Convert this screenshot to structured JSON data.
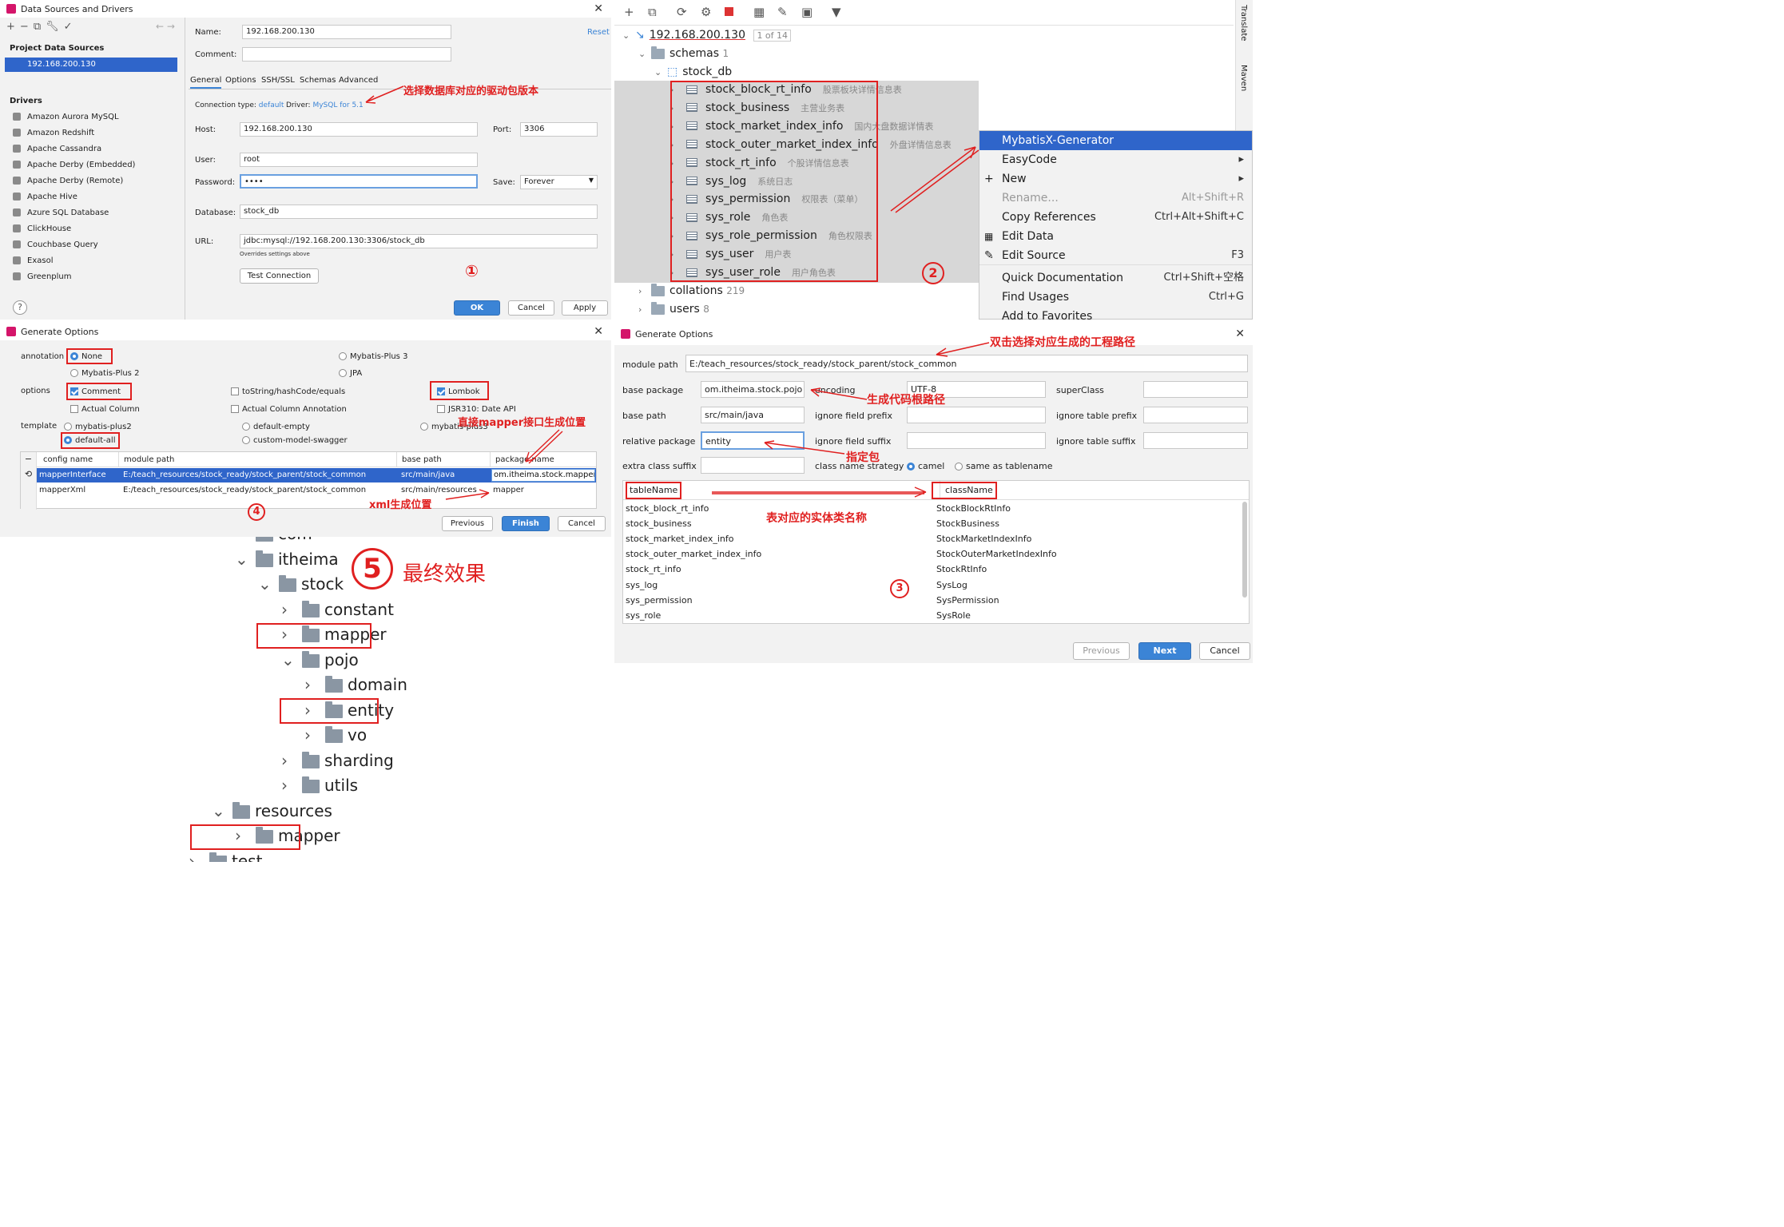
{
  "p1": {
    "title": "Data Sources and Drivers",
    "project_label": "Project Data Sources",
    "selected_source": "192.168.200.130",
    "drivers_label": "Drivers",
    "drivers": [
      "Amazon Aurora MySQL",
      "Amazon Redshift",
      "Apache Cassandra",
      "Apache Derby (Embedded)",
      "Apache Derby (Remote)",
      "Apache Hive",
      "Azure SQL Database",
      "ClickHouse",
      "Couchbase Query",
      "Exasol",
      "Greenplum"
    ],
    "name_label": "Name:",
    "name_value": "192.168.200.130",
    "reset": "Reset",
    "comment_label": "Comment:",
    "tabs": [
      "General",
      "Options",
      "SSH/SSL",
      "Schemas",
      "Advanced"
    ],
    "conn_type_label": "Connection type:",
    "conn_type": "default",
    "driver_label": "Driver:",
    "driver": "MySQL for 5.1",
    "host_label": "Host:",
    "host": "192.168.200.130",
    "port_label": "Port:",
    "port": "3306",
    "user_label": "User:",
    "user": "root",
    "password_label": "Password:",
    "password": "••••",
    "save_label": "Save:",
    "save": "Forever",
    "database_label": "Database:",
    "database": "stock_db",
    "url_label": "URL:",
    "url": "jdbc:mysql://192.168.200.130:3306/stock_db",
    "overrides": "Overrides settings above",
    "test_btn": "Test Connection",
    "ok": "OK",
    "cancel": "Cancel",
    "apply": "Apply",
    "anno": "选择数据库对应的驱动包版本",
    "num": "①"
  },
  "p2": {
    "host": "192.168.200.130",
    "of": "1 of 14",
    "schemas": "schemas",
    "schemas_count": "1",
    "db": "stock_db",
    "tables": [
      {
        "name": "stock_block_rt_info",
        "comment": "股票板块详情信息表"
      },
      {
        "name": "stock_business",
        "comment": "主营业务表"
      },
      {
        "name": "stock_market_index_info",
        "comment": "国内大盘数据详情表"
      },
      {
        "name": "stock_outer_market_index_info",
        "comment": "外盘详情信息表"
      },
      {
        "name": "stock_rt_info",
        "comment": "个股详情信息表"
      },
      {
        "name": "sys_log",
        "comment": "系统日志"
      },
      {
        "name": "sys_permission",
        "comment": "权限表（菜单）"
      },
      {
        "name": "sys_role",
        "comment": "角色表"
      },
      {
        "name": "sys_role_permission",
        "comment": "角色权限表"
      },
      {
        "name": "sys_user",
        "comment": "用户表"
      },
      {
        "name": "sys_user_role",
        "comment": "用户角色表"
      }
    ],
    "collations": "collations",
    "collations_count": "219",
    "users": "users",
    "users_count": "8",
    "menu": [
      {
        "label": "MybatisX-Generator",
        "shortcut": ""
      },
      {
        "label": "EasyCode",
        "shortcut": "▸"
      },
      {
        "label": "New",
        "shortcut": "▸"
      },
      {
        "label": "Rename...",
        "shortcut": "Alt+Shift+R"
      },
      {
        "label": "Copy References",
        "shortcut": "Ctrl+Alt+Shift+C"
      },
      {
        "label": "Edit Data",
        "shortcut": ""
      },
      {
        "label": "Edit Source",
        "shortcut": "F3"
      },
      {
        "label": "Quick Documentation",
        "shortcut": "Ctrl+Shift+空格"
      },
      {
        "label": "Find Usages",
        "shortcut": "Ctrl+G"
      },
      {
        "label": "Add to Favorites",
        "shortcut": ""
      }
    ],
    "side_tabs": [
      "Translate",
      "Maven"
    ],
    "num": "②"
  },
  "p4": {
    "title": "Generate Options",
    "annotation_label": "annotation",
    "ann_none": "None",
    "ann_mp2": "Mybatis-Plus 2",
    "ann_mp3": "Mybatis-Plus 3",
    "ann_jpa": "JPA",
    "options_label": "options",
    "opt_comment": "Comment",
    "opt_tostring": "toString/hashCode/equals",
    "opt_lombok": "Lombok",
    "opt_actual_col": "Actual Column",
    "opt_actual_col_ann": "Actual Column Annotation",
    "opt_jsr": "JSR310: Date API",
    "template_label": "template",
    "tpl_mp2": "mybatis-plus2",
    "tpl_empty": "default-empty",
    "tpl_mp3": "mybatis-plus3",
    "tpl_all": "default-all",
    "tpl_swagger": "custom-model-swagger",
    "cols": [
      "config name",
      "module path",
      "base path",
      "package name"
    ],
    "rows": [
      [
        "mapperInterface",
        "E:/teach_resources/stock_ready/stock_parent/stock_common",
        "src/main/java",
        "om.itheima.stock.mapper"
      ],
      [
        "mapperXml",
        "E:/teach_resources/stock_ready/stock_parent/stock_common",
        "src/main/resources",
        "mapper"
      ]
    ],
    "previous": "Previous",
    "finish": "Finish",
    "cancel": "Cancel",
    "anno_mapper": "直接mapper接口生成位置",
    "anno_xml": "xml生成位置",
    "num": "④"
  },
  "p3": {
    "title": "Generate Options",
    "module_path_label": "module path",
    "module_path": "E:/teach_resources/stock_ready/stock_parent/stock_common",
    "base_package_label": "base package",
    "base_package": "om.itheima.stock.pojo",
    "encoding_label": "encoding",
    "encoding": "UTF-8",
    "superclass_label": "superClass",
    "base_path_label": "base path",
    "base_path": "src/main/java",
    "ignore_field_prefix": "ignore field prefix",
    "ignore_table_prefix": "ignore table prefix",
    "relative_package_label": "relative package",
    "relative_package": "entity",
    "ignore_field_suffix": "ignore field suffix",
    "ignore_table_suffix": "ignore table suffix",
    "extra_class_suffix": "extra class suffix",
    "class_name_strategy": "class name strategy",
    "camel": "camel",
    "same": "same as tablename",
    "col_table": "tableName",
    "col_class": "className",
    "rows": [
      [
        "stock_block_rt_info",
        "StockBlockRtInfo"
      ],
      [
        "stock_business",
        "StockBusiness"
      ],
      [
        "stock_market_index_info",
        "StockMarketIndexInfo"
      ],
      [
        "stock_outer_market_index_info",
        "StockOuterMarketIndexInfo"
      ],
      [
        "stock_rt_info",
        "StockRtInfo"
      ],
      [
        "sys_log",
        "SysLog"
      ],
      [
        "sys_permission",
        "SysPermission"
      ],
      [
        "sys_role",
        "SysRole"
      ]
    ],
    "previous": "Previous",
    "next": "Next",
    "cancel": "Cancel",
    "anno_path": "双击选择对应生成的工程路径",
    "anno_root": "生成代码根路径",
    "anno_pkg": "指定包",
    "anno_entity": "表对应的实体类名称",
    "num": "③"
  },
  "p5": {
    "anno": "最终效果",
    "num": "⑤",
    "tree": [
      "com",
      "itheima",
      "stock",
      "constant",
      "mapper",
      "pojo",
      "domain",
      "entity",
      "vo",
      "sharding",
      "utils",
      "resources",
      "mapper",
      "test"
    ]
  },
  "colors": {
    "accent": "#3b84d6",
    "red": "#e02020",
    "select": "#2f65ca"
  }
}
